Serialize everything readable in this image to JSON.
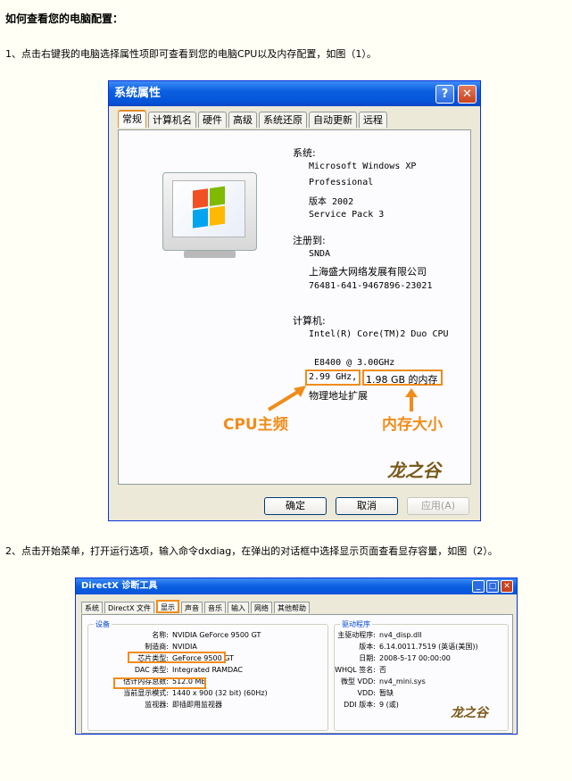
{
  "heading": "如何查看您的电脑配置：",
  "step1": "1、点击右键我的电脑选择属性项即可查看到您的电脑CPU以及内存配置，如图（1）。",
  "step2": "2、点击开始菜单，打开运行选项，输入命令dxdiag，在弹出的对话框中选择显示页面查看显存容量，如图（2）。",
  "sysprops": {
    "title": "系统属性",
    "help_glyph": "?",
    "close_glyph": "✕",
    "tabs": [
      "常规",
      "计算机名",
      "硬件",
      "高级",
      "系统还原",
      "自动更新",
      "远程"
    ],
    "system_label": "系统:",
    "os_line1": "Microsoft Windows XP",
    "os_line2": "Professional",
    "version": "版本 2002",
    "service_pack": "Service Pack 3",
    "registered_label": "注册到:",
    "reg_user": "SNDA",
    "reg_org": "上海盛大网络发展有限公司",
    "reg_key": "76481-641-9467896-23021",
    "computer_label": "计算机:",
    "cpu_line": "Intel(R) Core(TM)2 Duo CPU",
    "cpu_model": "E8400  @ 3.00GHz",
    "cpu_freq": "2.99 GHz,",
    "memory": "1.98 GB 的内存",
    "pae": "物理地址扩展",
    "annot_cpu": "CPU主频",
    "annot_mem": "内存大小",
    "ok": "确定",
    "cancel": "取消",
    "apply": "应用(A)",
    "watermark": "龙之谷"
  },
  "dxdiag": {
    "title": "DirectX 诊断工具",
    "tabs": [
      "系统",
      "DirectX 文件",
      "显示",
      "声音",
      "音乐",
      "输入",
      "网络",
      "其他帮助"
    ],
    "device_group": "设备",
    "driver_group": "驱动程序",
    "device_rows": [
      {
        "label": "名称:",
        "value": "NVIDIA GeForce 9500 GT"
      },
      {
        "label": "制造商:",
        "value": "NVIDIA"
      },
      {
        "label": "芯片类型:",
        "value": "GeForce 9500 GT"
      },
      {
        "label": "DAC 类型:",
        "value": "Integrated RAMDAC"
      },
      {
        "label": "估计内存总数:",
        "value": "512.0 MB"
      },
      {
        "label": "当前显示模式:",
        "value": "1440 x 900 (32 bit) (60Hz)"
      },
      {
        "label": "监视器:",
        "value": "即插即用监视器"
      }
    ],
    "driver_rows": [
      {
        "label": "主驱动程序:",
        "value": "nv4_disp.dll"
      },
      {
        "label": "版本:",
        "value": "6.14.0011.7519 (英语(美国))"
      },
      {
        "label": "日期:",
        "value": "2008-5-17 00:00:00"
      },
      {
        "label": "WHQL 签名:",
        "value": "否"
      },
      {
        "label": "微型 VDD:",
        "value": "nv4_mini.sys"
      },
      {
        "label": "VDD:",
        "value": "暂缺"
      },
      {
        "label": "DDI 版本:",
        "value": "9 (或)"
      }
    ],
    "watermark": "龙之谷"
  }
}
